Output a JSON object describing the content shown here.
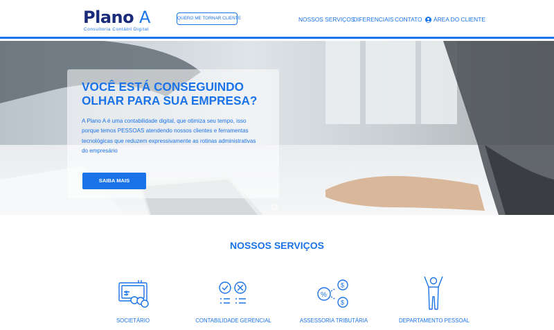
{
  "header": {
    "logo": {
      "main": "Plano",
      "accent": "A",
      "tagline": "Consultoria Contábil Digital"
    },
    "cta_label": "QUERO ME TORNAR CLIENTE",
    "nav": [
      {
        "label": "NOSSOS SERVIÇOS"
      },
      {
        "label": "DIFERENCIAIS"
      },
      {
        "label": "CONTATO"
      },
      {
        "label": "ÁREA DO CLIENTE",
        "icon": "user-circle-icon"
      }
    ]
  },
  "hero": {
    "title": "VOCÊ ESTÁ CONSEGUINDO OLHAR PARA SUA EMPRESA?",
    "text": "A Plano A é uma contabilidade digital, que otimiza seu tempo, isso porque temos PESSOAS atendendo nossos clientes e ferramentas tecnológicas que reduzem expressivamente as rotinas administrativas do empresário",
    "button_label": "SAIBA MAIS"
  },
  "services": {
    "title": "NOSSOS SERVIÇOS",
    "items": [
      {
        "label": "SOCIETÁRIO",
        "icon": "certificate-money-icon"
      },
      {
        "label": "CONTABILIDADE GERENCIAL",
        "icon": "checklist-icon"
      },
      {
        "label": "ASSESSORIA TRIBUTÁRIA",
        "icon": "tax-percent-icon"
      },
      {
        "label": "DEPARTAMENTO PESSOAL",
        "icon": "person-arms-up-icon"
      }
    ]
  },
  "colors": {
    "brand_blue": "#1a73e8",
    "logo_navy": "#1a2a7a"
  }
}
